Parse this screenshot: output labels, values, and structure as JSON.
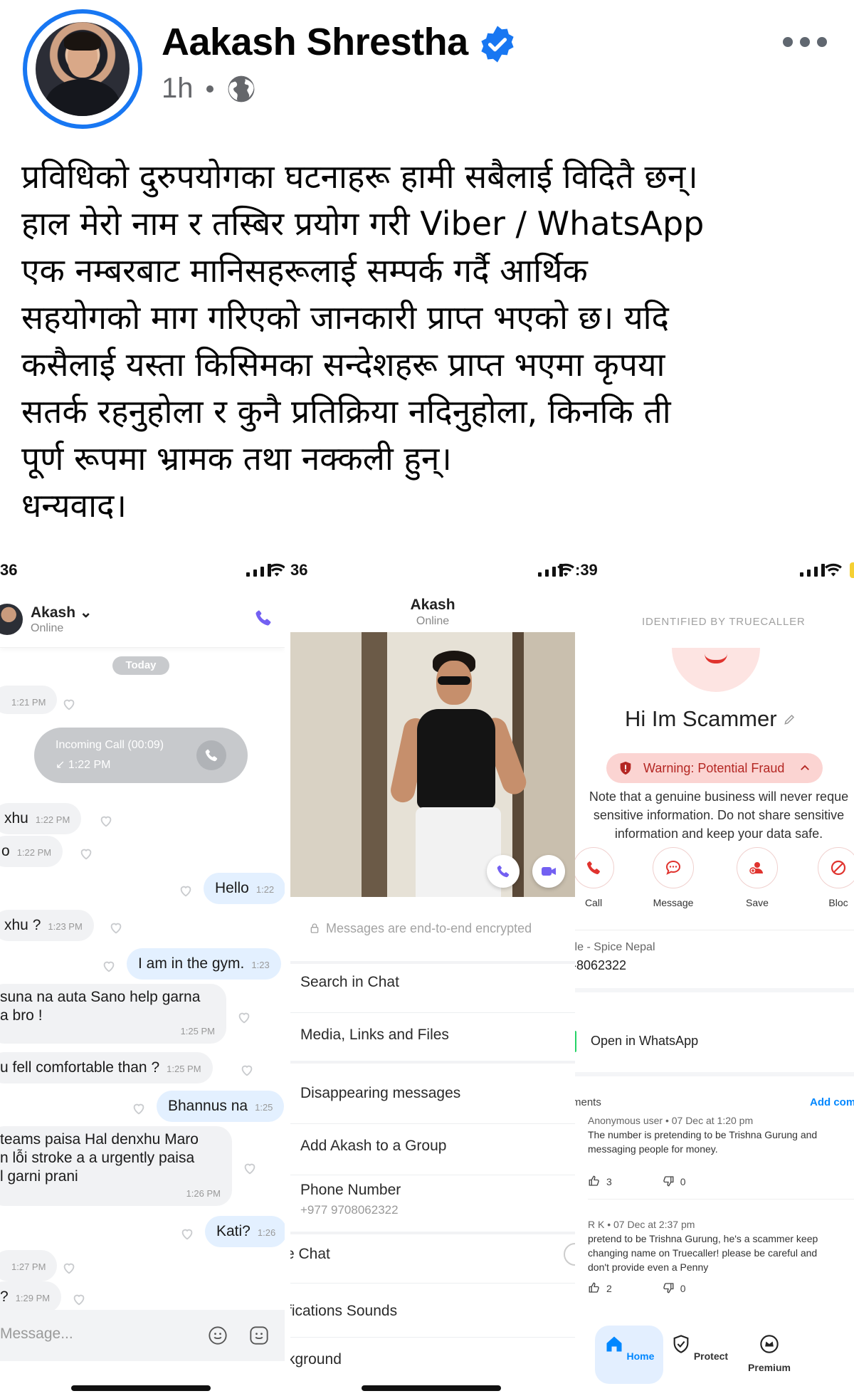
{
  "post": {
    "author": "Aakash Shrestha",
    "time": "1h",
    "audience_icon": "globe-icon",
    "verified_color": "#1877f2",
    "lines": [
      "प्रविधिको दुरुपयोगका घटनाहरू हामी सबैलाई विदितै छन्।",
      "हाल मेरो नाम र तस्बिर प्रयोग गरी Viber / WhatsApp",
      "एक नम्बरबाट मानिसहरूलाई सम्पर्क गर्दै आर्थिक",
      "सहयोगको माग गरिएको जानकारी प्राप्त भएको छ। यदि",
      "कसैलाई यस्ता किसिमका सन्देशहरू प्राप्त भएमा कृपया",
      "सतर्क रहनुहोला र कुनै प्रतिक्रिया नदिनुहोला, किनकि ती",
      "पूर्ण रूपमा भ्रामक तथा नक्कली हुन्।",
      "धन्यवाद।"
    ]
  },
  "chat": {
    "clock": "36",
    "contact_name": "Akash ⌄",
    "contact_status": "Online",
    "date_pill": "Today",
    "call_title": "Incoming Call (00:09)",
    "call_time": "↙ 1:22 PM",
    "messages": [
      {
        "text": "",
        "time": "1:21 PM"
      },
      {
        "text": "xhu",
        "time": "1:22 PM"
      },
      {
        "text": "o",
        "time": "1:22 PM"
      },
      {
        "text": "Hello",
        "time": "1:22"
      },
      {
        "text": "xhu ?",
        "time": "1:23 PM"
      },
      {
        "text": "I am in the gym.",
        "time": "1:23"
      },
      {
        "text": "suna na auta Sano help garna",
        "text2": "a bro !",
        "time": "1:25 PM"
      },
      {
        "text": "u fell comfortable than ?",
        "time": "1:25 PM"
      },
      {
        "text": "Bhannus na",
        "time": "1:25"
      },
      {
        "text": "teams paisa Hal denxhu Maro",
        "text2": "n lỗi stroke a a urgently paisa",
        "text3": "l garni prani",
        "time": "1:26 PM"
      },
      {
        "text": "Kati?",
        "time": "1:26"
      },
      {
        "text": "",
        "time": "1:27 PM"
      },
      {
        "text": "?",
        "time": "1:29 PM"
      }
    ],
    "input_placeholder": "Message..."
  },
  "contact": {
    "clock": "36",
    "name": "Akash",
    "status": "Online",
    "encryption_note": "Messages are end-to-end encrypted",
    "menu": [
      "Search in Chat",
      "Media, Links and Files",
      "Disappearing messages",
      "Add Akash to a Group",
      "Phone Number",
      "e Chat",
      "fications Sounds",
      "kground"
    ],
    "phone_number": "+977 9708062322"
  },
  "truecaller": {
    "clock": ":39",
    "identified_label": "IDENTIFIED BY TRUECALLER",
    "caller_name": "Hi Im Scammer",
    "warning": "Warning: Potential Fraud",
    "note_lines": [
      "Note that a genuine business will never reque",
      "sensitive information. Do not share sensitive",
      "information and keep your data safe."
    ],
    "actions": [
      "Call",
      "Message",
      "Save",
      "Bloc"
    ],
    "carrier": "ile - Spice Nepal",
    "number": "-8062322",
    "open_whatsapp": "Open in WhatsApp",
    "comments_label": "ments",
    "add_comment": "Add com",
    "comments": [
      {
        "meta": "Anonymous user  •  07 Dec at 1:20 pm",
        "body": [
          "The number is pretending to be Trishna Gurung and",
          "messaging people for money."
        ],
        "likes": "3",
        "dislikes": "0"
      },
      {
        "meta": "R K  •  07 Dec at 2:37 pm",
        "body": [
          "pretend to be Trishna Gurung, he's a scammer keep",
          "changing name on Truecaller! please be careful and",
          "don't provide even a Penny"
        ],
        "likes": "2",
        "dislikes": "0"
      }
    ],
    "nav": [
      "Home",
      "Protect",
      "Premium"
    ],
    "accent": "#0087ff",
    "warning_color": "#b42723"
  }
}
